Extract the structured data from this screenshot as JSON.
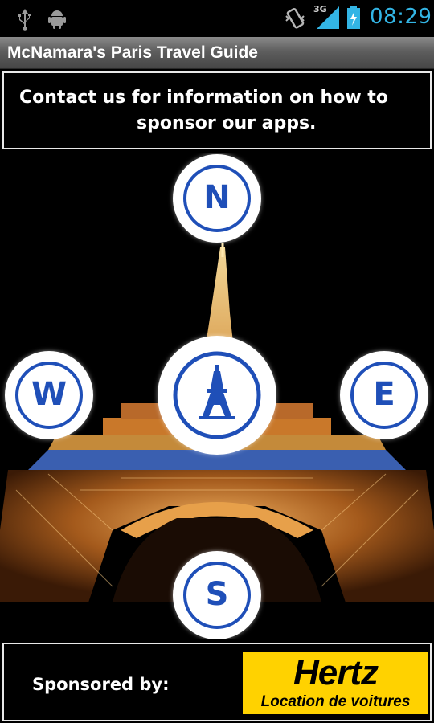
{
  "status_bar": {
    "time": "08:29",
    "network": "3G",
    "icons": [
      "usb-icon",
      "android-debug-icon",
      "vibrate-icon",
      "signal-icon",
      "battery-charging-icon"
    ]
  },
  "app": {
    "title": "McNamara's Paris Travel Guide"
  },
  "contact": {
    "line1": "Contact us for information on how to",
    "line2": "sponsor our apps."
  },
  "compass": {
    "north": "N",
    "west": "W",
    "east": "E",
    "south": "S",
    "center_icon": "eiffel-tower-icon"
  },
  "sponsor": {
    "label": "Sponsored by:",
    "brand": "Hertz",
    "tagline": "Location de voitures"
  },
  "colors": {
    "compass_blue": "#1f4fb8",
    "clock_blue": "#33b5e5",
    "hertz_yellow": "#ffd200"
  }
}
